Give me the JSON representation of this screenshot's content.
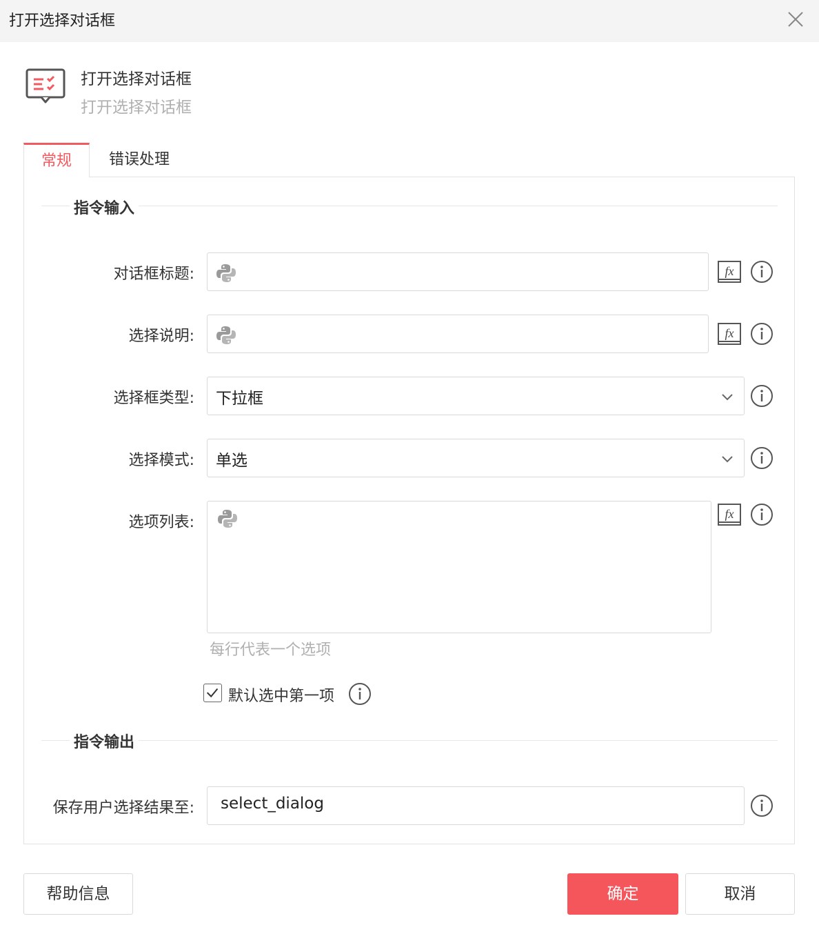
{
  "window": {
    "title": "打开选择对话框"
  },
  "header": {
    "title": "打开选择对话框",
    "subtitle": "打开选择对话框"
  },
  "tabs": [
    {
      "label": "常规",
      "active": true
    },
    {
      "label": "错误处理",
      "active": false
    }
  ],
  "sections": {
    "input_title": "指令输入",
    "output_title": "指令输出"
  },
  "fields": {
    "dialog_title": {
      "label": "对话框标题:",
      "value": ""
    },
    "select_desc": {
      "label": "选择说明:",
      "value": ""
    },
    "select_type": {
      "label": "选择框类型:",
      "value": "下拉框"
    },
    "select_mode": {
      "label": "选择模式:",
      "value": "单选"
    },
    "options_list": {
      "label": "选项列表:",
      "value": "",
      "hint": "每行代表一个选项"
    },
    "default_first": {
      "label": "默认选中第一项",
      "checked": true
    },
    "save_result": {
      "label": "保存用户选择结果至:",
      "value": "select_dialog"
    }
  },
  "buttons": {
    "help": "帮助信息",
    "ok": "确定",
    "cancel": "取消"
  },
  "colors": {
    "accent": "#f15a5f",
    "ok_button": "#f5565b",
    "border": "#d9d9d9"
  },
  "icons": [
    "close-icon",
    "dialog-icon",
    "python-icon",
    "fx-icon",
    "info-icon",
    "chevron-down-icon",
    "checkbox-check-icon"
  ]
}
